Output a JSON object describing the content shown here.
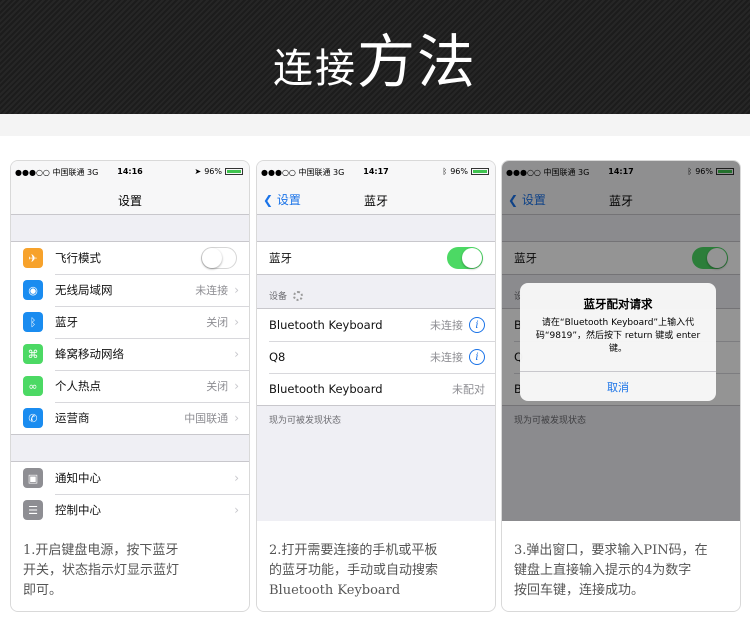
{
  "banner": {
    "title_small": "连接",
    "title_big": "方法"
  },
  "status_bar": {
    "carrier": "●●●○○ 中国联通  3G",
    "battery": "96%"
  },
  "panels": [
    {
      "time": "14:16",
      "nav_title": "设置",
      "group1": [
        {
          "icon": "airplane-icon",
          "glyph": "✈",
          "color": "#f7a22b",
          "label": "飞行模式",
          "control": "toggle-off"
        },
        {
          "icon": "wifi-icon",
          "glyph": "◉",
          "color": "#1a8cf0",
          "label": "无线局域网",
          "value": "未连接"
        },
        {
          "icon": "bluetooth-icon",
          "glyph": "ᛒ",
          "color": "#1a8cf0",
          "label": "蓝牙",
          "value": "关闭"
        },
        {
          "icon": "cellular-icon",
          "glyph": "⌘",
          "color": "#4cd964",
          "label": "蜂窝移动网络",
          "value": ""
        },
        {
          "icon": "hotspot-icon",
          "glyph": "∞",
          "color": "#4cd964",
          "label": "个人热点",
          "value": "关闭"
        },
        {
          "icon": "phone-icon",
          "glyph": "✆",
          "color": "#1a8cf0",
          "label": "运营商",
          "value": "中国联通"
        }
      ],
      "group2": [
        {
          "icon": "notification-center-icon",
          "glyph": "▣",
          "color": "#8e8e93",
          "label": "通知中心"
        },
        {
          "icon": "control-center-icon",
          "glyph": "☰",
          "color": "#8e8e93",
          "label": "控制中心"
        }
      ],
      "caption": [
        "1.开启键盘电源，按下蓝牙",
        "开关，状态指示灯显示蓝灯",
        "即可。"
      ]
    },
    {
      "time": "14:17",
      "nav_back": "设置",
      "nav_title": "蓝牙",
      "bt_label": "蓝牙",
      "devices_label": "设备",
      "devices": [
        {
          "name": "Bluetooth Keyboard",
          "status": "未连接",
          "info": true
        },
        {
          "name": "Q8",
          "status": "未连接",
          "info": true
        },
        {
          "name": "Bluetooth Keyboard",
          "status": "未配对",
          "info": false
        }
      ],
      "footer": "现为可被发现状态",
      "caption": [
        "2.打开需要连接的手机或平板",
        "的蓝牙功能，手动或自动搜索",
        "Bluetooth Keyboard"
      ]
    },
    {
      "time": "14:17",
      "nav_back": "设置",
      "nav_title": "蓝牙",
      "bt_label": "蓝牙",
      "devices_label": "设",
      "devices": [
        {
          "name": "B",
          "status": "",
          "info": false
        },
        {
          "name": "Q",
          "status": "",
          "info": false
        },
        {
          "name": "B",
          "status": "",
          "info": false
        }
      ],
      "footer": "现为可被发现状态",
      "alert": {
        "title": "蓝牙配对请求",
        "message": "请在“Bluetooth Keyboard”上输入代码“9819”，然后按下 return 键或 enter 键。",
        "button": "取消"
      },
      "caption": [
        "3.弹出窗口，要求输入PIN码，在",
        "键盘上直接输入提示的4为数字",
        "按回车键，连接成功。"
      ]
    }
  ]
}
